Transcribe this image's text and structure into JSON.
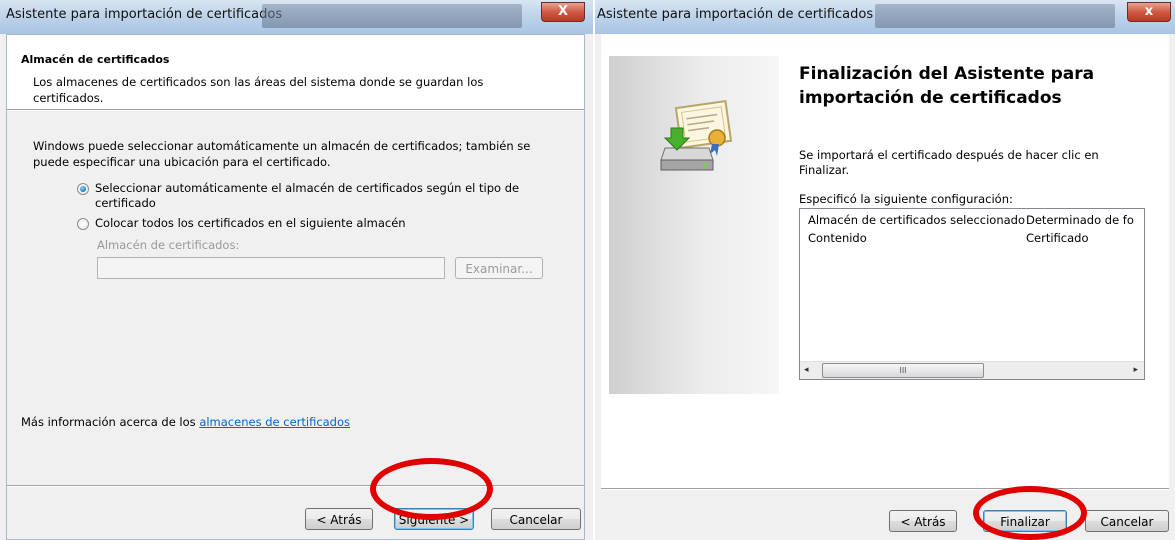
{
  "left": {
    "title": "Asistente para importación de certificados",
    "close_label": "X",
    "section_title": "Almacén de certificados",
    "section_desc_line1": "Los almacenes de certificados son las áreas del sistema donde se guardan los",
    "section_desc_line2": "certificados.",
    "intro_line1": "Windows puede seleccionar automáticamente un almacén de certificados; también se",
    "intro_line2": "puede especificar una ubicación para el certificado.",
    "radio_auto_line1": "Seleccionar automáticamente el almacén de certificados según el tipo de",
    "radio_auto_line2": "certificado",
    "radio_manual": "Colocar todos los certificados en el siguiente almacén",
    "store_label": "Almacén de certificados:",
    "store_value": "",
    "browse_label": "Examinar...",
    "more_info_prefix": "Más información acerca de los ",
    "more_info_link": "almacenes de certificados",
    "back_label": "< Atrás",
    "next_label": "Siguiente >",
    "cancel_label": "Cancelar"
  },
  "right": {
    "title": "Asistente para importación de certificados",
    "close_label": "x",
    "heading_line1": "Finalización del Asistente para",
    "heading_line2": "importación de certificados",
    "info_line1": "Se importará el certificado después de hacer clic en",
    "info_line2": "Finalizar.",
    "config_label": "Especificó la siguiente configuración:",
    "config_rows": [
      {
        "name": "Almacén de certificados seleccionado",
        "value": "Determinado de fo"
      },
      {
        "name": "Contenido",
        "value": "Certificado"
      }
    ],
    "scroll_thumb_grip": "III",
    "back_label": "< Atrás",
    "finish_label": "Finalizar",
    "cancel_label": "Cancelar"
  },
  "colors": {
    "highlight_ring": "#e10000",
    "link": "#0066cc"
  }
}
